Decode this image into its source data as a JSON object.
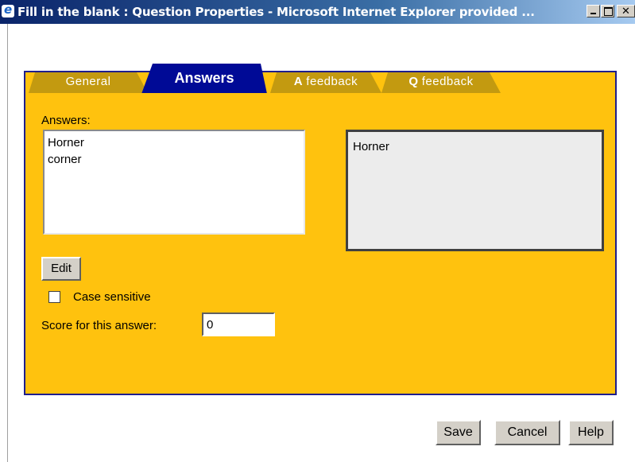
{
  "window": {
    "title": "Fill in the blank : Question Properties - Microsoft Internet Explorer provided ..."
  },
  "tabs": {
    "general": "General",
    "answers": "Answers",
    "a_feedback_prefix": "A",
    "a_feedback": " feedback",
    "q_feedback_prefix": "Q",
    "q_feedback": " feedback"
  },
  "answers_panel": {
    "label": "Answers:",
    "items": [
      "Horner",
      "corner"
    ],
    "preview": "Horner",
    "edit_label": "Edit",
    "case_sensitive_label": "Case sensitive",
    "case_sensitive_checked": false,
    "score_label": "Score for this answer:",
    "score_value": "0"
  },
  "footer": {
    "save_label": "Save",
    "cancel_label": "Cancel",
    "help_label": "Help"
  },
  "colors": {
    "panel_bg": "#ffc20e",
    "active_tab": "#000a96",
    "inactive_tab": "#c39a10"
  }
}
